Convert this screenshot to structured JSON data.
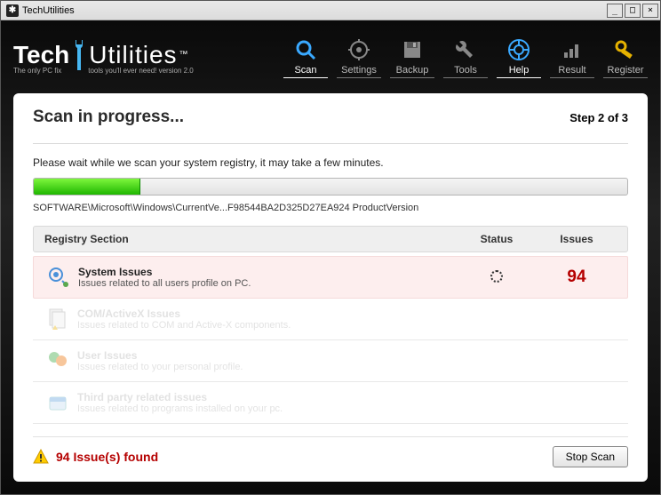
{
  "window": {
    "title": "TechUtilities"
  },
  "brand": {
    "left": "Tech",
    "right": "Utilities",
    "tm": "™",
    "tagline_left": "The only PC fix",
    "tagline_right": "tools you'll ever need! version 2.0"
  },
  "toolbar": [
    {
      "key": "scan",
      "label": "Scan",
      "active": true
    },
    {
      "key": "settings",
      "label": "Settings",
      "active": false
    },
    {
      "key": "backup",
      "label": "Backup",
      "active": false
    },
    {
      "key": "tools",
      "label": "Tools",
      "active": false
    },
    {
      "key": "help",
      "label": "Help",
      "active": true
    },
    {
      "key": "result",
      "label": "Result",
      "active": false
    },
    {
      "key": "register",
      "label": "Register",
      "active": false
    }
  ],
  "panel": {
    "title": "Scan in progress...",
    "step": "Step 2 of 3",
    "wait": "Please wait while we scan your system registry, it may take a few minutes.",
    "progress_pct": 18,
    "path": "SOFTWARE\\Microsoft\\Windows\\CurrentVe...F98544BA2D325D27EA924 ProductVersion"
  },
  "table": {
    "headers": {
      "section": "Registry Section",
      "status": "Status",
      "issues": "Issues"
    },
    "rows": [
      {
        "title": "System Issues",
        "desc": "Issues related to all users profile on PC.",
        "status": "loading",
        "issues": "94",
        "active": true
      },
      {
        "title": "COM/ActiveX Issues",
        "desc": "Issues related to COM and Active-X components.",
        "status": "",
        "issues": "",
        "active": false
      },
      {
        "title": "User Issues",
        "desc": "Issues related to your personal profile.",
        "status": "",
        "issues": "",
        "active": false
      },
      {
        "title": "Third party related issues",
        "desc": "Issues related to programs installed on your pc.",
        "status": "",
        "issues": "",
        "active": false
      }
    ]
  },
  "footer": {
    "found": "94 Issue(s) found",
    "stop": "Stop Scan"
  }
}
